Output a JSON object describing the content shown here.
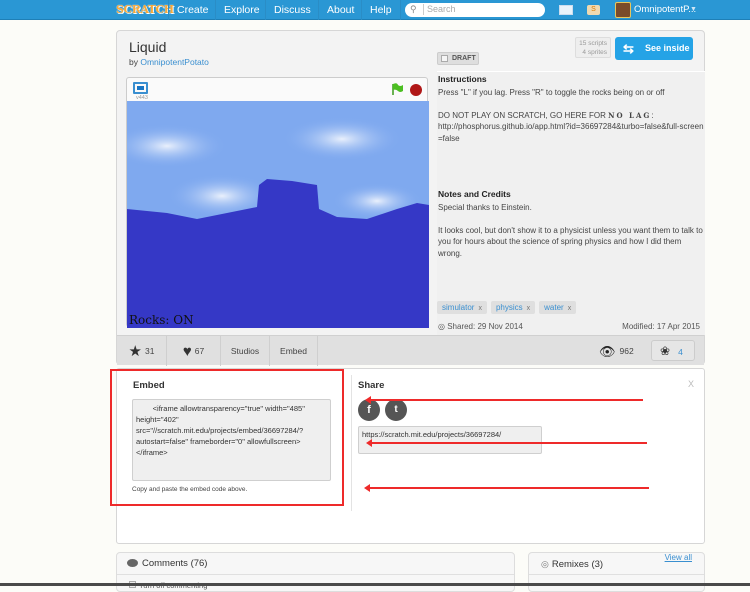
{
  "nav": {
    "logo": "SCRATCH",
    "links": [
      "Create",
      "Explore",
      "Discuss",
      "About",
      "Help"
    ],
    "search_placeholder": "Search",
    "username": "OmnipotentP...",
    "mystuff_glyph": "S",
    "brand_color": "#2a97d4"
  },
  "project": {
    "title": "Liquid",
    "by_label": "by",
    "author": "OmnipotentPotato",
    "draft_label": "DRAFT",
    "scripts": "15 scripts",
    "sprites": "4 sprites",
    "see_inside": "See inside",
    "player_version": "v443",
    "stage_text": "Rocks: ON"
  },
  "instructions": {
    "heading": "Instructions",
    "line1": "Press \"L\" if you lag. Press \"R\" to toggle the rocks being on or off",
    "line2_prefix": "DO NOT PLAY ON SCRATCH, GO HERE FOR ",
    "line2_nolag": "NO LAG",
    "line2_suffix": ":",
    "link": "http://phosphorus.github.io/app.html?id=36697284&turbo=false&full-screen=false"
  },
  "notes": {
    "heading": "Notes and Credits",
    "line1": "Special thanks to Einstein.",
    "line2": "It looks cool, but don't show it to a physicist unless you want them to talk to you for hours about the science of spring physics and how I did them wrong."
  },
  "tags": [
    {
      "label": "simulator",
      "remove": "x"
    },
    {
      "label": "physics",
      "remove": "x"
    },
    {
      "label": "water",
      "remove": "x"
    }
  ],
  "dates": {
    "shared": "Shared: 29 Nov 2014",
    "modified": "Modified: 17 Apr 2015"
  },
  "stats": {
    "favorites": "31",
    "loves": "67",
    "studios_label": "Studios",
    "embed_label": "Embed",
    "views": "962",
    "remixes": "4"
  },
  "embed": {
    "heading": "Embed",
    "code": "        <iframe allowtransparency=\"true\" width=\"485\" height=\"402\" src=\"//scratch.mit.edu/projects/embed/36697284/?autostart=false\" frameborder=\"0\" allowfullscreen></iframe>",
    "help": "Copy and paste the embed code above."
  },
  "share": {
    "heading": "Share",
    "close": "X",
    "facebook": "f",
    "twitter": "t",
    "url": "https://scratch.mit.edu/projects/36697284/"
  },
  "comments": {
    "heading": "Comments (76)",
    "toggle": "Turn off commenting"
  },
  "remixes": {
    "heading": "Remixes (3)",
    "view_all": "View all"
  },
  "annotation_color": "#ee2a2a"
}
